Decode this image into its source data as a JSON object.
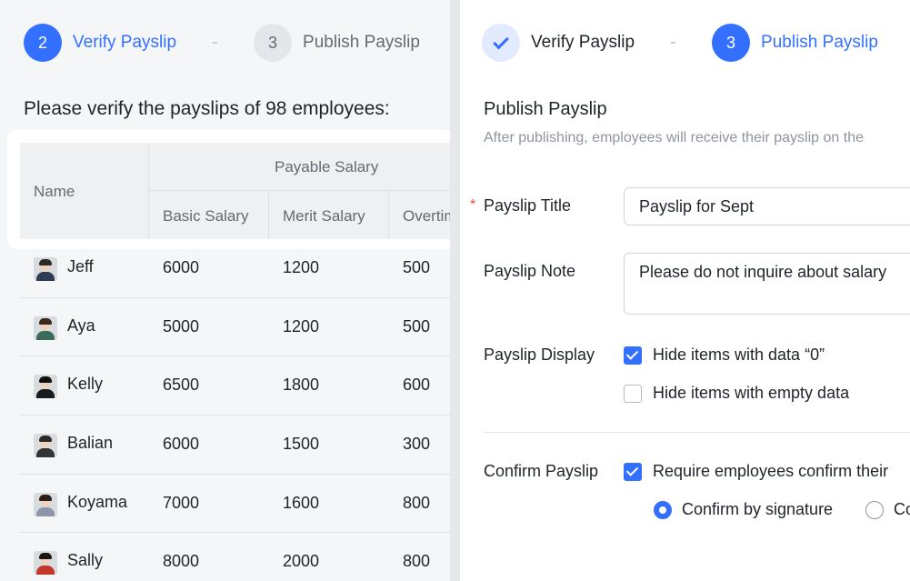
{
  "left": {
    "steps": [
      {
        "number": "2",
        "label": "Verify Payslip"
      },
      {
        "number": "3",
        "label": "Publish Payslip"
      }
    ],
    "title": "Please verify the payslips of 98 employees:",
    "table": {
      "header_name": "Name",
      "header_group": "Payable Salary",
      "headers": [
        "Basic Salary",
        "Merit  Salary",
        "Overtime"
      ],
      "rows": [
        {
          "name": "Jeff",
          "basic": "6000",
          "merit": "1200",
          "overtime": "500"
        },
        {
          "name": "Aya",
          "basic": "5000",
          "merit": "1200",
          "overtime": "500"
        },
        {
          "name": "Kelly",
          "basic": "6500",
          "merit": "1800",
          "overtime": "600"
        },
        {
          "name": "Balian",
          "basic": "6000",
          "merit": "1500",
          "overtime": "300"
        },
        {
          "name": "Koyama",
          "basic": "7000",
          "merit": "1600",
          "overtime": "800"
        },
        {
          "name": "Sally",
          "basic": "8000",
          "merit": "2000",
          "overtime": "800"
        }
      ]
    }
  },
  "right": {
    "steps": [
      {
        "number": "",
        "label": "Verify Payslip",
        "state": "done"
      },
      {
        "number": "3",
        "label": "Publish Payslip",
        "state": "active"
      }
    ],
    "title": "Publish Payslip",
    "description": "After publishing, employees will receive their payslip on the",
    "form": {
      "title_label": "Payslip Title",
      "title_value": "Payslip for Sept",
      "note_label": "Payslip Note",
      "note_value": "Please do not inquire about salary",
      "display_label": "Payslip Display",
      "display_options": [
        {
          "label": "Hide items with data “0”",
          "checked": true
        },
        {
          "label": "Hide items with empty data",
          "checked": false
        }
      ],
      "confirm_label": "Confirm Payslip",
      "confirm_option": {
        "label": "Require employees confirm their",
        "checked": true
      },
      "confirm_methods": [
        {
          "label": "Confirm by signature",
          "selected": true
        },
        {
          "label": "Co",
          "selected": false
        }
      ]
    }
  },
  "colors": {
    "accent": "#3370ff",
    "required": "#f54a45"
  }
}
